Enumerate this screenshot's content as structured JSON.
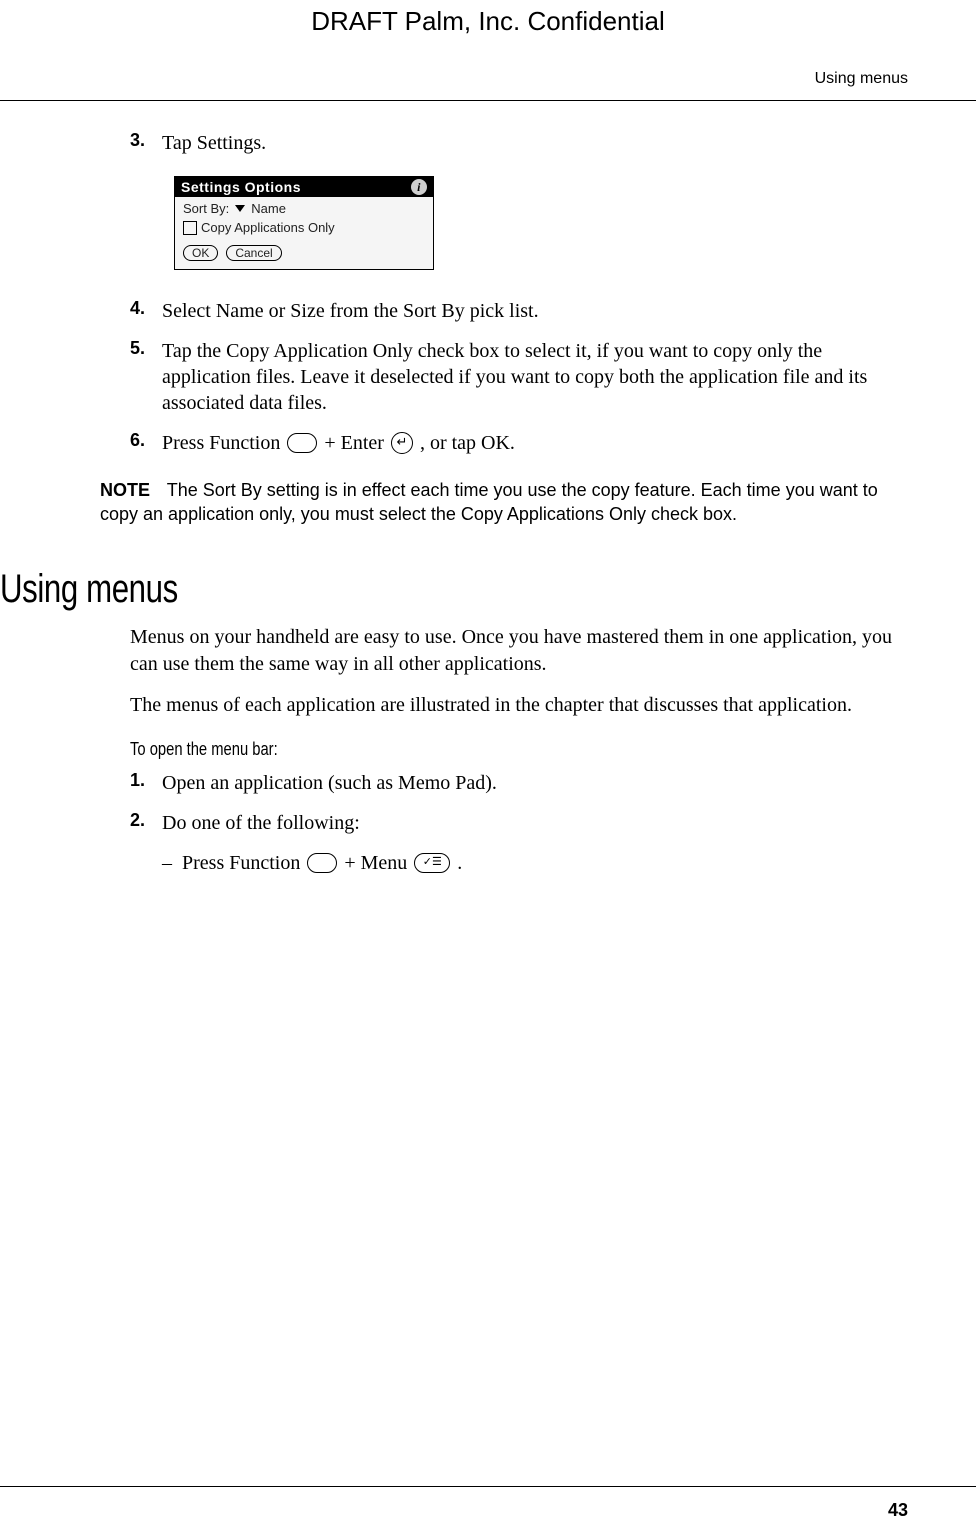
{
  "draft_header": "DRAFT   Palm, Inc. Confidential",
  "running_header": "Using menus",
  "page_number": "43",
  "steps_block1": {
    "step3": {
      "num": "3.",
      "text": "Tap Settings."
    },
    "step4": {
      "num": "4.",
      "text": "Select Name or Size from the Sort By pick list."
    },
    "step5": {
      "num": "5.",
      "text": "Tap the Copy Application Only check box to select it, if you want to copy only the application files. Leave it deselected if you want to copy both the application file and its associated data files."
    },
    "step6": {
      "num": "6.",
      "pre": "Press Function ",
      "mid1": " + Enter ",
      "post": ", or tap OK."
    }
  },
  "settings_dialog": {
    "title": "Settings Options",
    "info_glyph": "i",
    "sort_by_label": "Sort By:",
    "sort_by_value": "Name",
    "checkbox_label": "Copy Applications Only",
    "ok": "OK",
    "cancel": "Cancel"
  },
  "note": {
    "label": "NOTE",
    "text": "The Sort By setting is in effect each time you use the copy feature. Each time you want to copy an application only, you must select the Copy Applications Only check box."
  },
  "section_heading": "Using menus",
  "para1": "Menus on your handheld are easy to use. Once you have mastered them in one application, you can use them the same way in all other applications.",
  "para2": "The menus of each application are illustrated in the chapter that discusses that application.",
  "sub_heading": "To open the menu bar:",
  "steps_block2": {
    "step1": {
      "num": "1.",
      "text": "Open an application (such as Memo Pad)."
    },
    "step2": {
      "num": "2.",
      "text": "Do one of the following:"
    },
    "dash": {
      "pre": "Press Function ",
      "mid": " + Menu ",
      "post": "."
    }
  },
  "key_glyphs": {
    "function": "",
    "enter": "↵",
    "menu": "✓☰"
  }
}
